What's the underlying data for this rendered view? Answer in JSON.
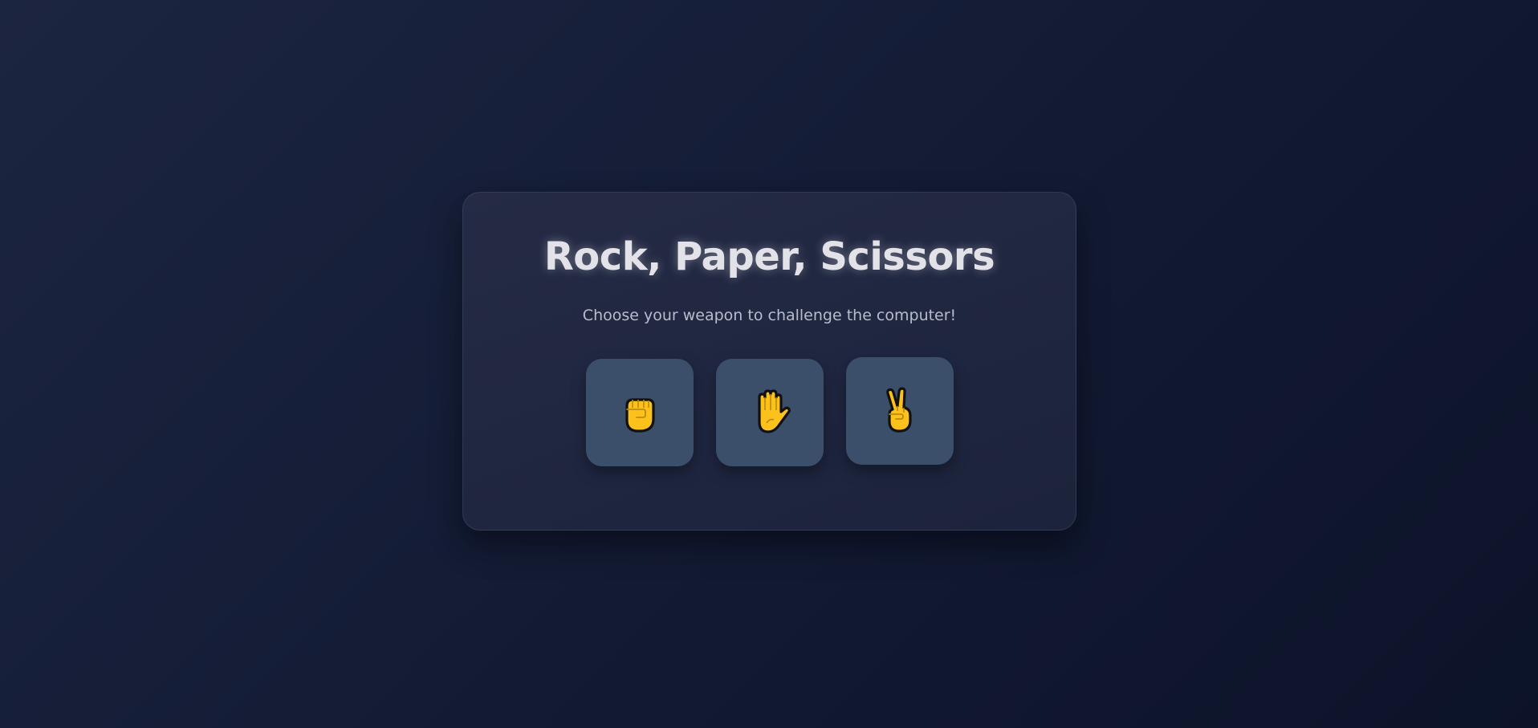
{
  "game": {
    "title": "Rock, Paper, Scissors",
    "subtitle": "Choose your weapon to challenge the computer!"
  },
  "choices": [
    {
      "name": "rock",
      "icon": "rock-fist-icon"
    },
    {
      "name": "paper",
      "icon": "paper-hand-icon"
    },
    {
      "name": "scissors",
      "icon": "scissors-victory-hand-icon"
    }
  ],
  "colors": {
    "background": "#141c36",
    "card": "#222940",
    "button": "#3b4f6b",
    "title": "#e2e2e8",
    "subtitle": "#b9bccb",
    "emoji_fill": "#fcc21b"
  }
}
